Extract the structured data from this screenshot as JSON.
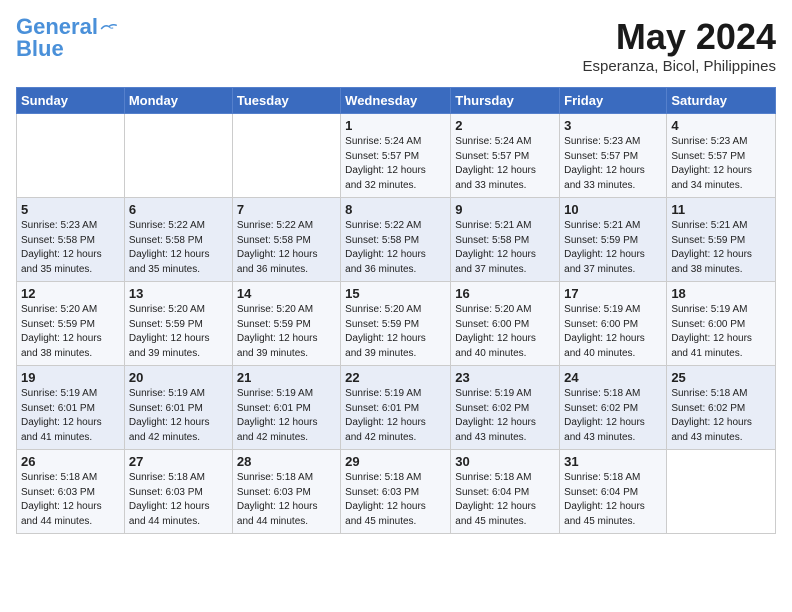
{
  "header": {
    "logo_line1": "General",
    "logo_line2": "Blue",
    "month": "May 2024",
    "location": "Esperanza, Bicol, Philippines"
  },
  "weekdays": [
    "Sunday",
    "Monday",
    "Tuesday",
    "Wednesday",
    "Thursday",
    "Friday",
    "Saturday"
  ],
  "weeks": [
    [
      {
        "day": "",
        "info": ""
      },
      {
        "day": "",
        "info": ""
      },
      {
        "day": "",
        "info": ""
      },
      {
        "day": "1",
        "info": "Sunrise: 5:24 AM\nSunset: 5:57 PM\nDaylight: 12 hours\nand 32 minutes."
      },
      {
        "day": "2",
        "info": "Sunrise: 5:24 AM\nSunset: 5:57 PM\nDaylight: 12 hours\nand 33 minutes."
      },
      {
        "day": "3",
        "info": "Sunrise: 5:23 AM\nSunset: 5:57 PM\nDaylight: 12 hours\nand 33 minutes."
      },
      {
        "day": "4",
        "info": "Sunrise: 5:23 AM\nSunset: 5:57 PM\nDaylight: 12 hours\nand 34 minutes."
      }
    ],
    [
      {
        "day": "5",
        "info": "Sunrise: 5:23 AM\nSunset: 5:58 PM\nDaylight: 12 hours\nand 35 minutes."
      },
      {
        "day": "6",
        "info": "Sunrise: 5:22 AM\nSunset: 5:58 PM\nDaylight: 12 hours\nand 35 minutes."
      },
      {
        "day": "7",
        "info": "Sunrise: 5:22 AM\nSunset: 5:58 PM\nDaylight: 12 hours\nand 36 minutes."
      },
      {
        "day": "8",
        "info": "Sunrise: 5:22 AM\nSunset: 5:58 PM\nDaylight: 12 hours\nand 36 minutes."
      },
      {
        "day": "9",
        "info": "Sunrise: 5:21 AM\nSunset: 5:58 PM\nDaylight: 12 hours\nand 37 minutes."
      },
      {
        "day": "10",
        "info": "Sunrise: 5:21 AM\nSunset: 5:59 PM\nDaylight: 12 hours\nand 37 minutes."
      },
      {
        "day": "11",
        "info": "Sunrise: 5:21 AM\nSunset: 5:59 PM\nDaylight: 12 hours\nand 38 minutes."
      }
    ],
    [
      {
        "day": "12",
        "info": "Sunrise: 5:20 AM\nSunset: 5:59 PM\nDaylight: 12 hours\nand 38 minutes."
      },
      {
        "day": "13",
        "info": "Sunrise: 5:20 AM\nSunset: 5:59 PM\nDaylight: 12 hours\nand 39 minutes."
      },
      {
        "day": "14",
        "info": "Sunrise: 5:20 AM\nSunset: 5:59 PM\nDaylight: 12 hours\nand 39 minutes."
      },
      {
        "day": "15",
        "info": "Sunrise: 5:20 AM\nSunset: 5:59 PM\nDaylight: 12 hours\nand 39 minutes."
      },
      {
        "day": "16",
        "info": "Sunrise: 5:20 AM\nSunset: 6:00 PM\nDaylight: 12 hours\nand 40 minutes."
      },
      {
        "day": "17",
        "info": "Sunrise: 5:19 AM\nSunset: 6:00 PM\nDaylight: 12 hours\nand 40 minutes."
      },
      {
        "day": "18",
        "info": "Sunrise: 5:19 AM\nSunset: 6:00 PM\nDaylight: 12 hours\nand 41 minutes."
      }
    ],
    [
      {
        "day": "19",
        "info": "Sunrise: 5:19 AM\nSunset: 6:01 PM\nDaylight: 12 hours\nand 41 minutes."
      },
      {
        "day": "20",
        "info": "Sunrise: 5:19 AM\nSunset: 6:01 PM\nDaylight: 12 hours\nand 42 minutes."
      },
      {
        "day": "21",
        "info": "Sunrise: 5:19 AM\nSunset: 6:01 PM\nDaylight: 12 hours\nand 42 minutes."
      },
      {
        "day": "22",
        "info": "Sunrise: 5:19 AM\nSunset: 6:01 PM\nDaylight: 12 hours\nand 42 minutes."
      },
      {
        "day": "23",
        "info": "Sunrise: 5:19 AM\nSunset: 6:02 PM\nDaylight: 12 hours\nand 43 minutes."
      },
      {
        "day": "24",
        "info": "Sunrise: 5:18 AM\nSunset: 6:02 PM\nDaylight: 12 hours\nand 43 minutes."
      },
      {
        "day": "25",
        "info": "Sunrise: 5:18 AM\nSunset: 6:02 PM\nDaylight: 12 hours\nand 43 minutes."
      }
    ],
    [
      {
        "day": "26",
        "info": "Sunrise: 5:18 AM\nSunset: 6:03 PM\nDaylight: 12 hours\nand 44 minutes."
      },
      {
        "day": "27",
        "info": "Sunrise: 5:18 AM\nSunset: 6:03 PM\nDaylight: 12 hours\nand 44 minutes."
      },
      {
        "day": "28",
        "info": "Sunrise: 5:18 AM\nSunset: 6:03 PM\nDaylight: 12 hours\nand 44 minutes."
      },
      {
        "day": "29",
        "info": "Sunrise: 5:18 AM\nSunset: 6:03 PM\nDaylight: 12 hours\nand 45 minutes."
      },
      {
        "day": "30",
        "info": "Sunrise: 5:18 AM\nSunset: 6:04 PM\nDaylight: 12 hours\nand 45 minutes."
      },
      {
        "day": "31",
        "info": "Sunrise: 5:18 AM\nSunset: 6:04 PM\nDaylight: 12 hours\nand 45 minutes."
      },
      {
        "day": "",
        "info": ""
      }
    ]
  ]
}
